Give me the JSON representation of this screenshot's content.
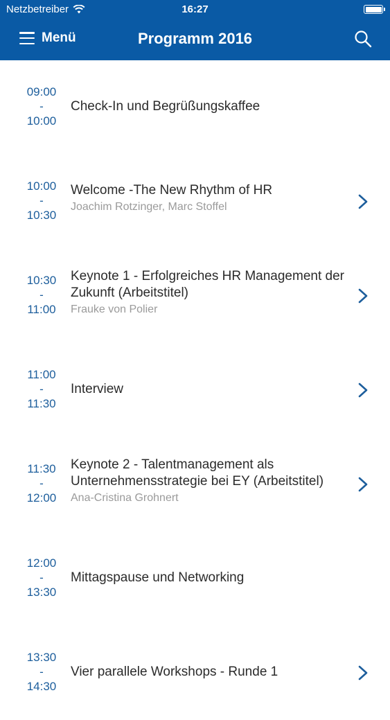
{
  "status_bar": {
    "carrier": "Netzbetreiber",
    "time": "16:27"
  },
  "nav": {
    "menu_label": "Menü",
    "title": "Programm 2016"
  },
  "colors": {
    "nav_background": "#0a5aa5",
    "time_text": "#1d5e9c",
    "speaker_text": "#9a9a9a",
    "chevron": "#1d5e9c"
  },
  "sessions": [
    {
      "start": "09:00",
      "sep": "-",
      "end": "10:00",
      "title": "Check-In und Begrüßungskaffee",
      "speaker": "",
      "has_detail": false
    },
    {
      "start": "10:00",
      "sep": "-",
      "end": "10:30",
      "title": "Welcome -The New Rhythm of HR",
      "speaker": "Joachim Rotzinger, Marc Stoffel",
      "has_detail": true
    },
    {
      "start": "10:30",
      "sep": "-",
      "end": "11:00",
      "title": "Keynote 1 - Erfolgreiches HR Management der Zukunft (Arbeitstitel)",
      "speaker": "Frauke von Polier",
      "has_detail": true
    },
    {
      "start": "11:00",
      "sep": "-",
      "end": "11:30",
      "title": "Interview",
      "speaker": "",
      "has_detail": true
    },
    {
      "start": "11:30",
      "sep": "-",
      "end": "12:00",
      "title": "Keynote 2 - Talentmanagement als Unternehmensstrategie bei EY (Arbeitstitel)",
      "speaker": "Ana-Cristina Grohnert",
      "has_detail": true
    },
    {
      "start": "12:00",
      "sep": "-",
      "end": "13:30",
      "title": "Mittagspause und Networking",
      "speaker": "",
      "has_detail": false
    },
    {
      "start": "13:30",
      "sep": "-",
      "end": "14:30",
      "title": "Vier parallele Workshops - Runde 1",
      "speaker": "",
      "has_detail": true
    }
  ]
}
